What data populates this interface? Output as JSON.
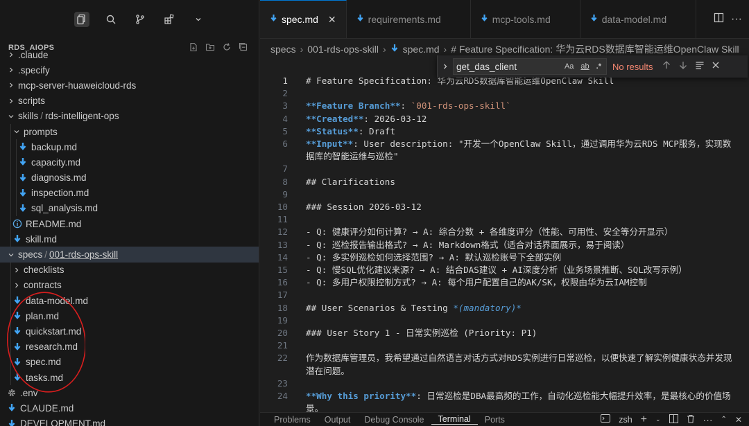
{
  "sidebar": {
    "section_title": "RDS_AIOPS",
    "tree": [
      {
        "label": "",
        "parts": [
          ".claude"
        ],
        "type": "folder",
        "state": "collapsed",
        "depth": 0
      },
      {
        "label": "",
        "parts": [
          ".specify"
        ],
        "type": "folder",
        "state": "collapsed",
        "depth": 0
      },
      {
        "label": "",
        "parts": [
          "mcp-server-huaweicloud-rds"
        ],
        "type": "folder",
        "state": "collapsed",
        "depth": 0
      },
      {
        "label": "",
        "parts": [
          "scripts"
        ],
        "type": "folder",
        "state": "collapsed",
        "depth": 0
      },
      {
        "label": "",
        "parts": [
          "skills",
          "rds-intelligent-ops"
        ],
        "type": "folder",
        "state": "expanded",
        "depth": 0
      },
      {
        "label": "",
        "parts": [
          "prompts"
        ],
        "type": "folder",
        "state": "expanded",
        "depth": 1
      },
      {
        "label": "",
        "parts": [
          "backup.md"
        ],
        "type": "md",
        "depth": 2
      },
      {
        "label": "",
        "parts": [
          "capacity.md"
        ],
        "type": "md",
        "depth": 2
      },
      {
        "label": "",
        "parts": [
          "diagnosis.md"
        ],
        "type": "md",
        "depth": 2
      },
      {
        "label": "",
        "parts": [
          "inspection.md"
        ],
        "type": "md",
        "depth": 2
      },
      {
        "label": "",
        "parts": [
          "sql_analysis.md"
        ],
        "type": "md",
        "depth": 2
      },
      {
        "label": "",
        "parts": [
          "README.md"
        ],
        "type": "info",
        "depth": 1
      },
      {
        "label": "",
        "parts": [
          "skill.md"
        ],
        "type": "md",
        "depth": 1
      },
      {
        "label": "",
        "parts": [
          "specs",
          "001-rds-ops-skill"
        ],
        "type": "folder",
        "state": "expanded",
        "depth": 0,
        "selected": true
      },
      {
        "label": "",
        "parts": [
          "checklists"
        ],
        "type": "folder",
        "state": "collapsed",
        "depth": 1
      },
      {
        "label": "",
        "parts": [
          "contracts"
        ],
        "type": "folder",
        "state": "collapsed",
        "depth": 1
      },
      {
        "label": "",
        "parts": [
          "data-model.md"
        ],
        "type": "md",
        "depth": 1
      },
      {
        "label": "",
        "parts": [
          "plan.md"
        ],
        "type": "md",
        "depth": 1
      },
      {
        "label": "",
        "parts": [
          "quickstart.md"
        ],
        "type": "md",
        "depth": 1
      },
      {
        "label": "",
        "parts": [
          "research.md"
        ],
        "type": "md",
        "depth": 1
      },
      {
        "label": "",
        "parts": [
          "spec.md"
        ],
        "type": "md",
        "depth": 1
      },
      {
        "label": "",
        "parts": [
          "tasks.md"
        ],
        "type": "md",
        "depth": 1
      },
      {
        "label": "",
        "parts": [
          ".env"
        ],
        "type": "gear",
        "depth": 0
      },
      {
        "label": "",
        "parts": [
          "CLAUDE.md"
        ],
        "type": "md",
        "depth": 0
      },
      {
        "label": "",
        "parts": [
          "DEVELOPMENT.md"
        ],
        "type": "md",
        "depth": 0
      }
    ]
  },
  "tabs": [
    {
      "label": "spec.md",
      "active": true
    },
    {
      "label": "requirements.md",
      "active": false
    },
    {
      "label": "mcp-tools.md",
      "active": false
    },
    {
      "label": "data-model.md",
      "active": false
    }
  ],
  "breadcrumb": [
    "specs",
    "001-rds-ops-skill",
    "spec.md",
    "# Feature Specification: 华为云RDS数据库智能运维OpenClaw Skill"
  ],
  "find": {
    "value": "get_das_client",
    "opt_case": "Aa",
    "opt_word": "ab",
    "opt_regex": ".*",
    "result": "No results"
  },
  "code_lines": [
    {
      "n": "1",
      "html": "# Feature Specification: 华为云RDS数据库智能运维OpenClaw Skill",
      "current": true
    },
    {
      "n": "2",
      "html": ""
    },
    {
      "n": "3",
      "segs": [
        [
          "b",
          "**Feature Branch**"
        ],
        [
          "t",
          ": "
        ],
        [
          "s",
          "`001-rds-ops-skill`"
        ]
      ]
    },
    {
      "n": "4",
      "segs": [
        [
          "b",
          "**Created**"
        ],
        [
          "t",
          ": 2026-03-12"
        ]
      ]
    },
    {
      "n": "5",
      "segs": [
        [
          "b",
          "**Status**"
        ],
        [
          "t",
          ": Draft"
        ]
      ]
    },
    {
      "n": "6",
      "segs": [
        [
          "b",
          "**Input**"
        ],
        [
          "t",
          ": User description: \"开发一个OpenClaw Skill，通过调用华为云RDS MCP服务，实现数据库的智能运维与巡检\""
        ]
      ]
    },
    {
      "n": "7",
      "html": ""
    },
    {
      "n": "8",
      "html": "## Clarifications"
    },
    {
      "n": "9",
      "html": ""
    },
    {
      "n": "10",
      "html": "### Session 2026-03-12"
    },
    {
      "n": "11",
      "html": ""
    },
    {
      "n": "12",
      "html": "- Q: 健康评分如何计算? → A: 综合分数 + 各维度评分（性能、可用性、安全等分开显示）"
    },
    {
      "n": "13",
      "html": "- Q: 巡检报告输出格式? → A: Markdown格式（适合对话界面展示，易于阅读）"
    },
    {
      "n": "14",
      "html": "- Q: 多实例巡检如何选择范围? → A: 默认巡检账号下全部实例"
    },
    {
      "n": "15",
      "html": "- Q: 慢SQL优化建议来源? → A: 结合DAS建议 + AI深度分析（业务场景推断、SQL改写示例）"
    },
    {
      "n": "16",
      "html": "- Q: 多用户权限控制方式? → A: 每个用户配置自己的AK/SK，权限由华为云IAM控制"
    },
    {
      "n": "17",
      "html": ""
    },
    {
      "n": "18",
      "segs": [
        [
          "t",
          "## User Scenarios & Testing "
        ],
        [
          "e",
          "*(mandatory)*"
        ]
      ]
    },
    {
      "n": "19",
      "html": ""
    },
    {
      "n": "20",
      "html": "### User Story 1 - 日常实例巡检 (Priority: P1)"
    },
    {
      "n": "21",
      "html": ""
    },
    {
      "n": "22",
      "html": "作为数据库管理员，我希望通过自然语言对话方式对RDS实例进行日常巡检，以便快速了解实例健康状态并发现潜在问题。"
    },
    {
      "n": "23",
      "html": ""
    },
    {
      "n": "24",
      "segs": [
        [
          "b",
          "**Why this priority**"
        ],
        [
          "t",
          ": 日常巡检是DBA最高频的工作，自动化巡检能大幅提升效率，是最核心的价值场景。"
        ]
      ]
    }
  ],
  "panel": {
    "tabs": [
      "Problems",
      "Output",
      "Debug Console",
      "Terminal",
      "Ports"
    ],
    "active": "Terminal",
    "shell": "zsh"
  }
}
